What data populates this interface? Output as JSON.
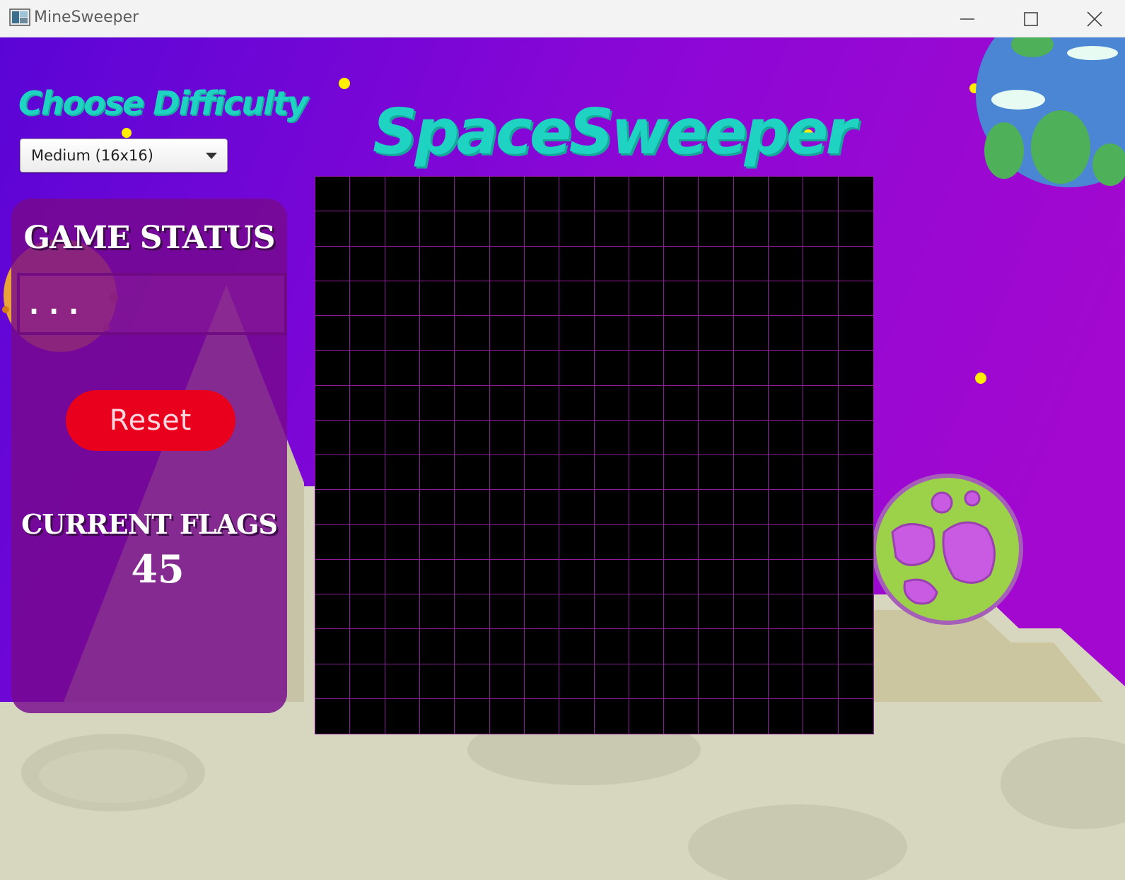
{
  "window": {
    "title": "MineSweeper",
    "icon": "app-icon",
    "controls": [
      "minimize-icon",
      "maximize-icon",
      "close-icon"
    ]
  },
  "game": {
    "title": "SpaceSweeper",
    "difficulty": {
      "heading": "Choose Difficulty",
      "selected": "Medium (16x16)"
    },
    "status_panel": {
      "title": "GAME STATUS",
      "status": "...",
      "reset_label": "Reset",
      "flags_title": "CURRENT FLAGS",
      "flags_count": "45"
    },
    "board": {
      "rows": 16,
      "columns": 16,
      "cell_color": "#000000",
      "grid_color": "#8e1a9c"
    }
  },
  "colors": {
    "title_teal": "#1fd3c3",
    "reset_red": "#e8001c",
    "panel_purple": "#76088c",
    "sky_purple": "#7a0ad8"
  }
}
